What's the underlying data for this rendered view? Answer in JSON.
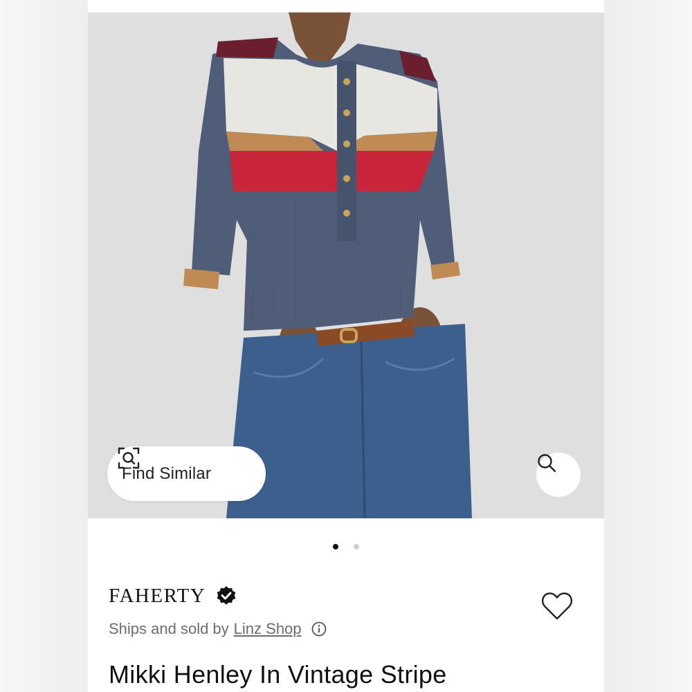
{
  "product": {
    "brand": "FAHERTY",
    "ships_prefix": "Ships and sold by",
    "seller": "Linz Shop",
    "title": "Mikki Henley In Vintage Stripe"
  },
  "image_actions": {
    "find_similar_label": "Find Similar"
  },
  "carousel": {
    "total": 2,
    "current": 1
  },
  "icons": {
    "find_similar": "scan-search-icon",
    "zoom": "magnifier-icon",
    "verified": "verified-badge-icon",
    "info": "info-icon",
    "favorite": "heart-icon"
  },
  "colors": {
    "sweater_navy": "#4f5d78",
    "stripe_cream": "#e8e6e1",
    "stripe_camel": "#c08a55",
    "stripe_red": "#c8243a",
    "stripe_burgundy": "#6b1f2e",
    "denim": "#3d5f8e"
  }
}
